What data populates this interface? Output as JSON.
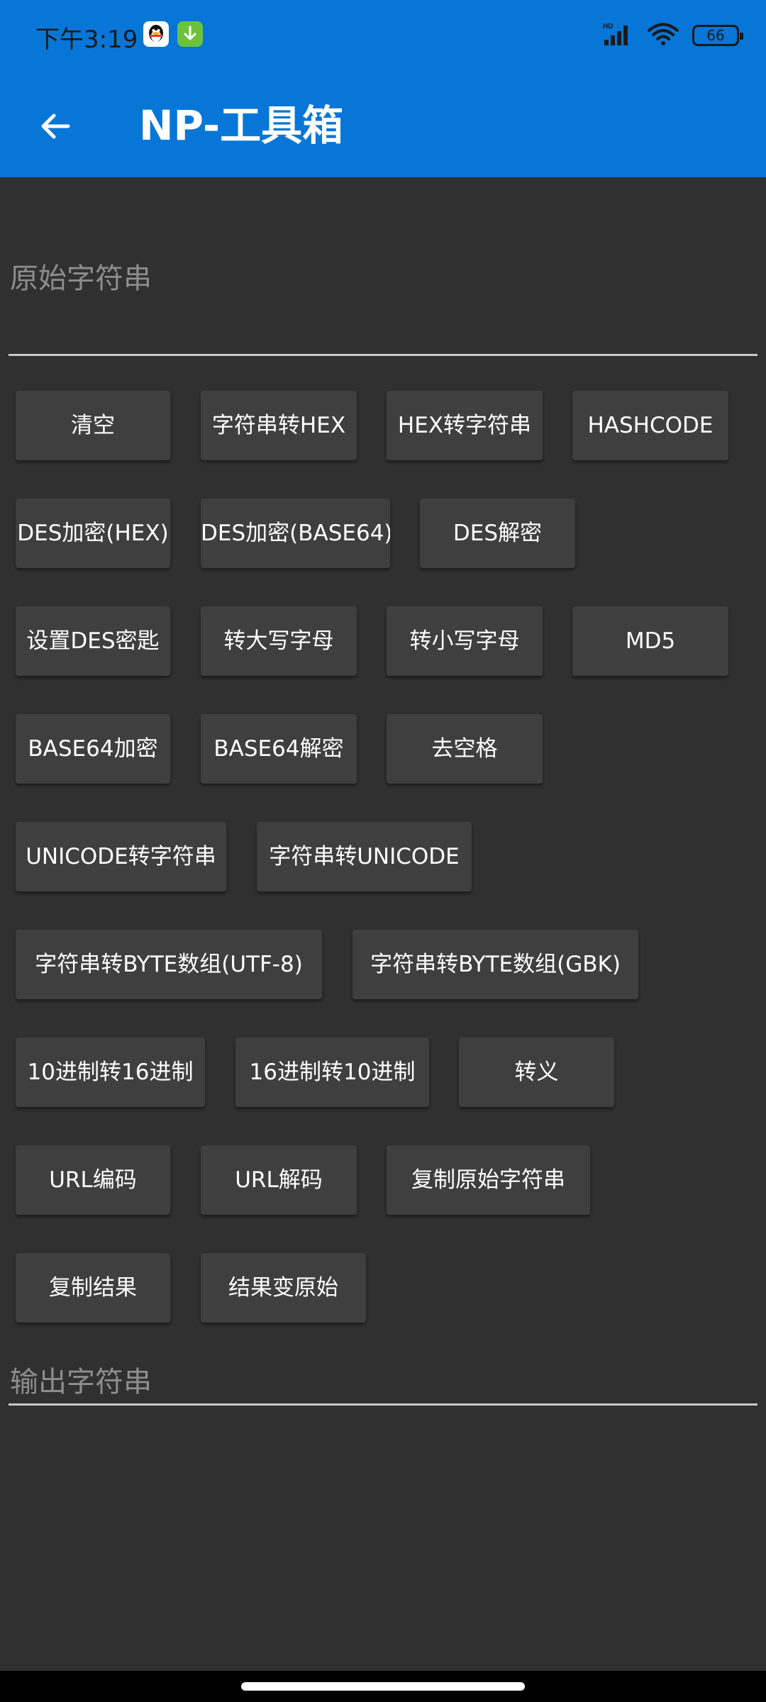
{
  "status": {
    "time": "下午3:19",
    "battery": "66",
    "icons": [
      "qq-icon",
      "download-icon",
      "hd-signal-icon",
      "wifi-icon",
      "battery-icon"
    ],
    "colors": {
      "appbar": "#0876d7",
      "background": "#303030",
      "button": "#3f3f3f"
    }
  },
  "appbar": {
    "title": "NP-工具箱",
    "back_icon": "arrow-back-icon"
  },
  "input": {
    "placeholder": "原始字符串"
  },
  "output": {
    "placeholder": "输出字符串"
  },
  "buttons": {
    "clear": "清空",
    "str_to_hex": "字符串转HEX",
    "hex_to_str": "HEX转字符串",
    "hashcode": "HASHCODE",
    "des_enc_hex": "DES加密(HEX)",
    "des_enc_b64": "DES加密(BASE64)",
    "des_dec": "DES解密",
    "set_des_key": "设置DES密匙",
    "to_upper": "转大写字母",
    "to_lower": "转小写字母",
    "md5": "MD5",
    "b64_enc": "BASE64加密",
    "b64_dec": "BASE64解密",
    "trim": "去空格",
    "unicode_to_str": "UNICODE转字符串",
    "str_to_unicode": "字符串转UNICODE",
    "bytes_utf8": "字符串转BYTE数组(UTF-8)",
    "bytes_gbk": "字符串转BYTE数组(GBK)",
    "dec_to_hex": "10进制转16进制",
    "hex_to_dec": "16进制转10进制",
    "escape": "转义",
    "url_enc": "URL编码",
    "url_dec": "URL解码",
    "copy_src": "复制原始字符串",
    "copy_result": "复制结果",
    "result_to_src": "结果变原始"
  }
}
